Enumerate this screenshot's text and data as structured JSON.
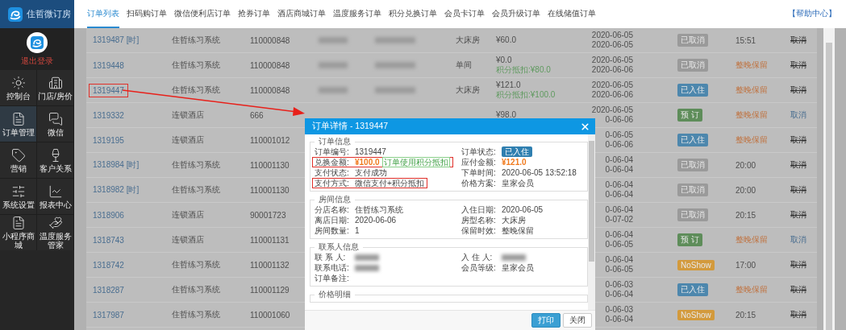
{
  "brand": {
    "name": "住哲微订房"
  },
  "sidebar": {
    "logout": "退出登录",
    "items": [
      {
        "label": "控制台",
        "selected": false
      },
      {
        "label": "门店/房价",
        "selected": false
      },
      {
        "label": "订单管理",
        "selected": true
      },
      {
        "label": "微信",
        "selected": false
      },
      {
        "label": "营销",
        "selected": false
      },
      {
        "label": "客户关系",
        "selected": false
      },
      {
        "label": "系统设置",
        "selected": false
      },
      {
        "label": "报表中心",
        "selected": false
      },
      {
        "label": "小程序商城",
        "selected": false
      },
      {
        "label": "温度服务管家",
        "selected": false
      }
    ]
  },
  "tabs": [
    {
      "label": "订单列表",
      "selected": true
    },
    {
      "label": "扫码购订单",
      "selected": false
    },
    {
      "label": "微信便利店订单",
      "selected": false
    },
    {
      "label": "抢券订单",
      "selected": false
    },
    {
      "label": "酒店商城订单",
      "selected": false
    },
    {
      "label": "温度服务订单",
      "selected": false
    },
    {
      "label": "积分兑换订单",
      "selected": false
    },
    {
      "label": "会员卡订单",
      "selected": false
    },
    {
      "label": "会员升级订单",
      "selected": false
    },
    {
      "label": "在线储值订单",
      "selected": false
    }
  ],
  "help_link": "【帮助中心】",
  "table": {
    "rows": [
      {
        "id": "1319487",
        "tag": "[时]",
        "branch": "住哲练习系统",
        "code": "110000848",
        "redacted": true,
        "room": "大床房",
        "price": "¥60.0",
        "dates": [
          "2020-06-05",
          "2020-06-05"
        ],
        "status": {
          "label": "已取消",
          "color": "#9a9a9a"
        },
        "retention": {
          "text": "15:51",
          "kind": "time"
        },
        "action": {
          "text": "取消",
          "disabled": true
        },
        "highlight": false
      },
      {
        "id": "1319448",
        "branch": "住哲练习系统",
        "code": "110000848",
        "redacted": true,
        "room": "单间",
        "price": "¥0.0",
        "points": "积分抵扣:¥80.0",
        "dates": [
          "2020-06-05",
          "2020-06-06"
        ],
        "status": {
          "label": "已取消",
          "color": "#9a9a9a"
        },
        "retention": {
          "text": "整晚保留",
          "kind": "hold"
        },
        "action": {
          "text": "取消",
          "disabled": true
        },
        "highlight": false
      },
      {
        "id": "1319447",
        "branch": "住哲练习系统",
        "code": "110000848",
        "redacted": true,
        "room": "大床房",
        "price": "¥121.0",
        "points": "积分抵扣:¥100.0",
        "dates": [
          "2020-06-05",
          "2020-06-06"
        ],
        "status": {
          "label": "已入住",
          "color": "#4d87ad"
        },
        "retention": {
          "text": "整晚保留",
          "kind": "hold"
        },
        "action": {
          "text": "取消",
          "disabled": true
        },
        "highlight": true
      },
      {
        "id": "1319332",
        "branch": "连锁酒店",
        "code": "666",
        "price": "¥98.0",
        "dates": [
          "2020-06-05",
          "0-06-06"
        ],
        "status": {
          "label": "预 订",
          "color": "#5e8d5a"
        },
        "retention": {
          "text": "整晚保留",
          "kind": "hold"
        },
        "action": {
          "text": "取消",
          "disabled": false
        },
        "highlight": false
      },
      {
        "id": "1319195",
        "branch": "连锁酒店",
        "code": "110001012",
        "dates": [
          "0-06-05",
          "0-06-06"
        ],
        "status": {
          "label": "已入住",
          "color": "#4d87ad"
        },
        "retention": {
          "text": "整晚保留",
          "kind": "hold"
        },
        "action": {
          "text": "取消",
          "disabled": true
        },
        "highlight": false
      },
      {
        "id": "1318984",
        "tag": "[时]",
        "branch": "住哲练习系统",
        "code": "110001130",
        "dates": [
          "0-06-04",
          "0-06-04"
        ],
        "status": {
          "label": "已取消",
          "color": "#9a9a9a"
        },
        "retention": {
          "text": "20:00",
          "kind": "time"
        },
        "action": {
          "text": "取消",
          "disabled": true
        },
        "highlight": false
      },
      {
        "id": "1318982",
        "tag": "[时]",
        "branch": "住哲练习系统",
        "code": "110001130",
        "dates": [
          "0-06-04",
          "0-06-04"
        ],
        "status": {
          "label": "已取消",
          "color": "#9a9a9a"
        },
        "retention": {
          "text": "20:00",
          "kind": "time"
        },
        "action": {
          "text": "取消",
          "disabled": true
        },
        "highlight": false
      },
      {
        "id": "1318906",
        "branch": "连锁酒店",
        "code": "90001723",
        "dates": [
          "0-06-04",
          "0-07-02"
        ],
        "status": {
          "label": "已取消",
          "color": "#9a9a9a"
        },
        "retention": {
          "text": "20:15",
          "kind": "time"
        },
        "action": {
          "text": "取消",
          "disabled": true
        },
        "highlight": false
      },
      {
        "id": "1318743",
        "branch": "连锁酒店",
        "code": "110001131",
        "dates": [
          "0-06-04",
          "0-06-05"
        ],
        "status": {
          "label": "预 订",
          "color": "#5e8d5a"
        },
        "retention": {
          "text": "整晚保留",
          "kind": "hold"
        },
        "action": {
          "text": "取消",
          "disabled": false
        },
        "highlight": false
      },
      {
        "id": "1318742",
        "branch": "住哲练习系统",
        "code": "110001132",
        "dates": [
          "0-06-04",
          "0-06-05"
        ],
        "status": {
          "label": "NoShow",
          "color": "#d39a3c"
        },
        "retention": {
          "text": "17:00",
          "kind": "time"
        },
        "action": {
          "text": "取消",
          "disabled": true
        },
        "highlight": false
      },
      {
        "id": "1318287",
        "branch": "住哲练习系统",
        "code": "110001129",
        "dates": [
          "0-06-03",
          "0-06-04"
        ],
        "status": {
          "label": "已入住",
          "color": "#4d87ad"
        },
        "retention": {
          "text": "整晚保留",
          "kind": "hold"
        },
        "action": {
          "text": "取消",
          "disabled": true
        },
        "highlight": false
      },
      {
        "id": "1317987",
        "branch": "住哲练习系统",
        "code": "110001060",
        "dates": [
          "0-06-03",
          "0-06-04"
        ],
        "status": {
          "label": "NoShow",
          "color": "#d39a3c"
        },
        "retention": {
          "text": "20:15",
          "kind": "time"
        },
        "action": {
          "text": "取消",
          "disabled": true
        },
        "highlight": false
      }
    ]
  },
  "modal": {
    "title": "订单详情 - 1319447",
    "sections": [
      {
        "legend": "订单信息",
        "fields": [
          {
            "label": "订单编号:",
            "kind": "text",
            "value": "1319447",
            "highlight": false
          },
          {
            "label": "订单状态:",
            "kind": "badge",
            "value": "已入住",
            "highlight": false
          },
          {
            "label": "兑换金额:",
            "kind": "amount",
            "value": "¥100.0",
            "note": "订单使用积分抵扣",
            "highlight": true
          },
          {
            "label": "应付金额:",
            "kind": "amount",
            "value": "¥121.0",
            "highlight": false
          },
          {
            "label": "支付状态:",
            "kind": "text",
            "value": "支付成功",
            "highlight": false
          },
          {
            "label": "下单时间:",
            "kind": "text",
            "value": "2020-06-05 13:52:18",
            "highlight": false
          },
          {
            "label": "支付方式:",
            "kind": "text",
            "value": "微信支付+积分抵扣",
            "highlight": true
          },
          {
            "label": "价格方案:",
            "kind": "text",
            "value": "皇家会员",
            "highlight": false
          }
        ]
      },
      {
        "legend": "房间信息",
        "fields": [
          {
            "label": "分店名称:",
            "kind": "text",
            "value": "住哲练习系统",
            "highlight": false
          },
          {
            "label": "入住日期:",
            "kind": "text",
            "value": "2020-06-05",
            "highlight": false
          },
          {
            "label": "离店日期:",
            "kind": "text",
            "value": "2020-06-06",
            "highlight": false
          },
          {
            "label": "房型名称:",
            "kind": "text",
            "value": "大床房",
            "highlight": false
          },
          {
            "label": "房间数量:",
            "kind": "text",
            "value": "1",
            "highlight": false
          },
          {
            "label": "保留时效:",
            "kind": "text",
            "value": "整晚保留",
            "highlight": false
          }
        ]
      },
      {
        "legend": "联系人信息",
        "fields": [
          {
            "label": "联 系 人:",
            "kind": "redacted",
            "highlight": false
          },
          {
            "label": "入 住 人:",
            "kind": "redacted",
            "highlight": false
          },
          {
            "label": "联系电话:",
            "kind": "redacted",
            "highlight": false
          },
          {
            "label": "会员等级:",
            "kind": "text",
            "value": "皇家会员",
            "highlight": false
          },
          {
            "label": "订单备注:",
            "kind": "text",
            "highlight": false
          }
        ]
      },
      {
        "legend": "价格明细"
      }
    ],
    "buttons": [
      {
        "label": "打印",
        "kind": "primary"
      },
      {
        "label": "关闭",
        "kind": "default"
      }
    ]
  }
}
